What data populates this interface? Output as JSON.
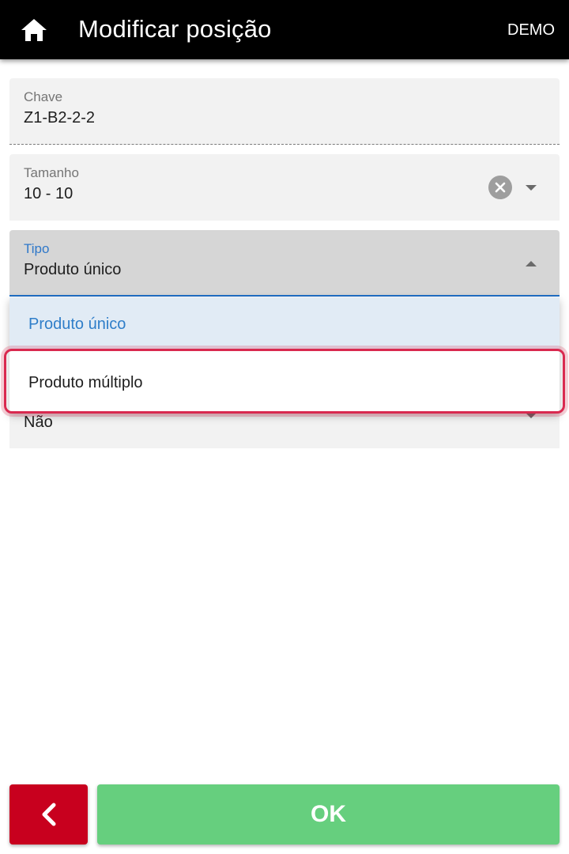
{
  "header": {
    "title": "Modificar posição",
    "demo_label": "DEMO",
    "home_icon": "home-icon"
  },
  "form": {
    "key": {
      "label": "Chave",
      "value": "Z1-B2-2-2"
    },
    "size": {
      "label": "Tamanho",
      "value": "10 - 10"
    },
    "type": {
      "label": "Tipo",
      "value": "Produto único",
      "options": [
        "Produto único",
        "Produto múltiplo"
      ]
    },
    "extra": {
      "value": "Não"
    }
  },
  "footer": {
    "back_icon": "chevron-left-icon",
    "ok_label": "OK"
  },
  "colors": {
    "appbar": "#000000",
    "accent": "#2f78c9",
    "back_button": "#c8001e",
    "ok_button": "#66cf7e",
    "highlight": "#d9294f"
  }
}
